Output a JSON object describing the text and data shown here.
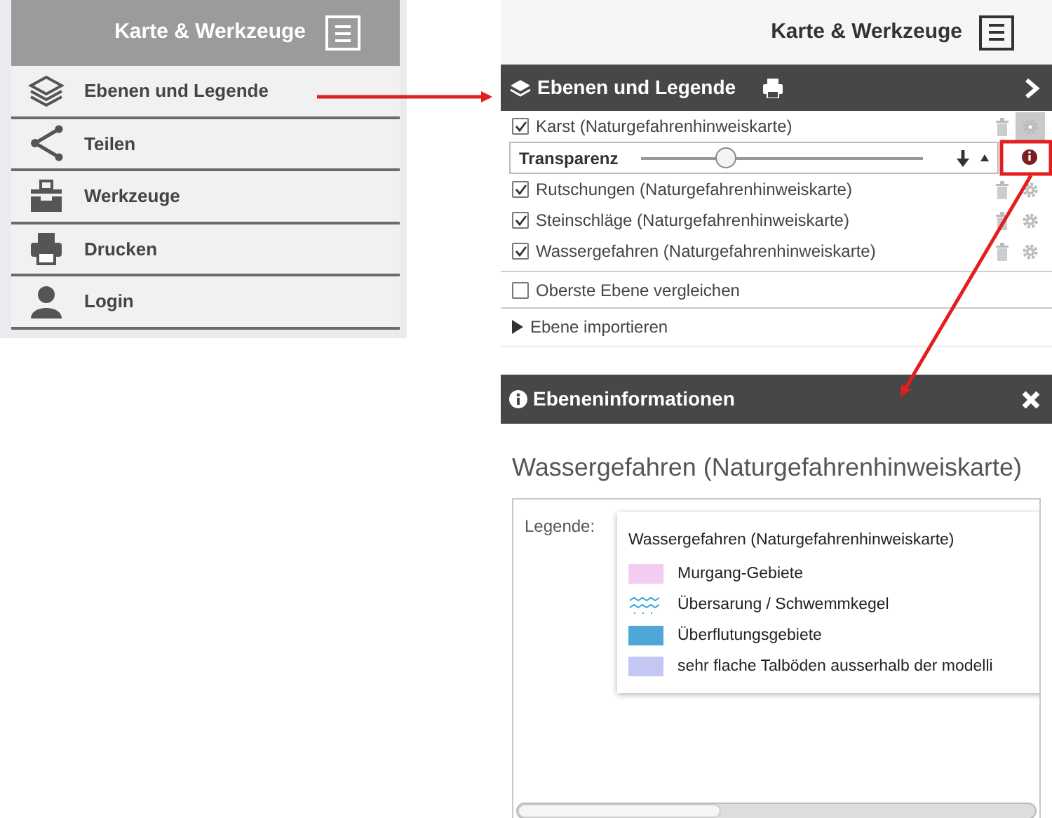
{
  "menu_panel": {
    "title": "Karte & Werkzeuge",
    "items": [
      {
        "label": "Ebenen und Legende"
      },
      {
        "label": "Teilen"
      },
      {
        "label": "Werkzeuge"
      },
      {
        "label": "Drucken"
      },
      {
        "label": "Login"
      }
    ]
  },
  "layers_panel": {
    "title": "Karte & Werkzeuge",
    "header": "Ebenen und Legende",
    "layers": [
      {
        "label": "Karst (Naturgefahrenhinweiskarte)",
        "checked": true,
        "expanded": true
      },
      {
        "label": "Rutschungen (Naturgefahrenhinweiskarte)",
        "checked": true,
        "expanded": false
      },
      {
        "label": "Steinschläge (Naturgefahrenhinweiskarte)",
        "checked": true,
        "expanded": false
      },
      {
        "label": "Wassergefahren (Naturgefahrenhinweiskarte)",
        "checked": true,
        "expanded": false
      }
    ],
    "transparency": {
      "label": "Transparenz",
      "level": 0.3
    },
    "compare": {
      "label": "Oberste Ebene vergleichen",
      "checked": false
    },
    "import": {
      "label": "Ebene importieren",
      "expanded": false
    }
  },
  "info_panel": {
    "header": "Ebeneninformationen",
    "title": "Wassergefahren (Naturgefahrenhinweiskarte)",
    "legend_label": "Legende:",
    "legend": {
      "title": "Wassergefahren (Naturgefahrenhinweiskarte)",
      "items": [
        {
          "label": "Murgang-Gebiete",
          "kind": "fill",
          "color": "#f2cdf0"
        },
        {
          "label": "Übersarung / Schwemmkegel",
          "kind": "wave",
          "color": "#3aa6d8"
        },
        {
          "label": "Überflutungsgebiete",
          "kind": "fill",
          "color": "#4ea7d6"
        },
        {
          "label": "sehr flache Talböden ausserhalb der modelli",
          "kind": "fill",
          "color": "#c4c6f4"
        }
      ]
    }
  }
}
